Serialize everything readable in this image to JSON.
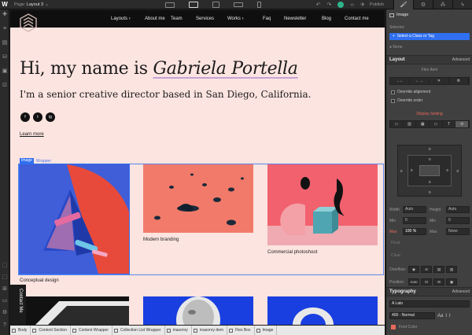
{
  "topbar": {
    "page_prefix": "Page:",
    "page_name": "Layout 3",
    "publish_label": "Publish",
    "colors": {
      "bg": "#2b2b2b",
      "active_tab": "#404040"
    }
  },
  "site": {
    "nav": [
      "Layouts",
      "About me",
      "Team",
      "Services",
      "Works",
      "Faq",
      "Newsletter",
      "Blog",
      "Contact me"
    ],
    "nav_chevron": "›",
    "hero_prefix": "Hi, my name is ",
    "hero_name": "Gabriela Portella",
    "subtitle": "I'm a senior creative director based in San Diego, California.",
    "socials": [
      "f",
      "t",
      "ig"
    ],
    "learn_more": "Learn more",
    "selection": {
      "element": "Image",
      "wrapper": "Wrapper"
    },
    "cards": [
      "Conceptual design",
      "Modern branding",
      "Commercial photoshoot"
    ],
    "contact_tab": "Contact Me"
  },
  "breadcrumbs": [
    "Body",
    "Content Section",
    "Content Wrapper",
    "Collection List Wrapper",
    "masonry",
    "masonry-item",
    "Flex Box",
    "Image"
  ],
  "panel": {
    "element_type": "Image",
    "selector_label": "Selector:",
    "selector_placeholder": "Select a Class or Tag",
    "state_none": "None",
    "layout_title": "Layout",
    "advanced": "Advanced",
    "flex_item": "Flex Item",
    "override_alignment": "Override alignment",
    "override_order": "Override order",
    "display_setting": "Display Setting",
    "width_label": "Width",
    "width_value": "Auto",
    "height_label": "Height",
    "height_value": "Auto",
    "min_label": "Min",
    "min_w": "0",
    "min_h": "0",
    "max_label": "Max",
    "max_w": "100",
    "max_w_unit": "%",
    "max_h": "None",
    "float_label": "Float:",
    "clear_label": "Clear:",
    "overflow_label": "Overflow:",
    "position_label": "Position:",
    "position_value": "Auto",
    "box_zero": "0",
    "typography_title": "Typography",
    "font_family": "Lato",
    "font_weight": "400 - Normal",
    "font_color_label": "Font Color",
    "accent": "#2f6ff0",
    "warning": "#e8695b"
  }
}
